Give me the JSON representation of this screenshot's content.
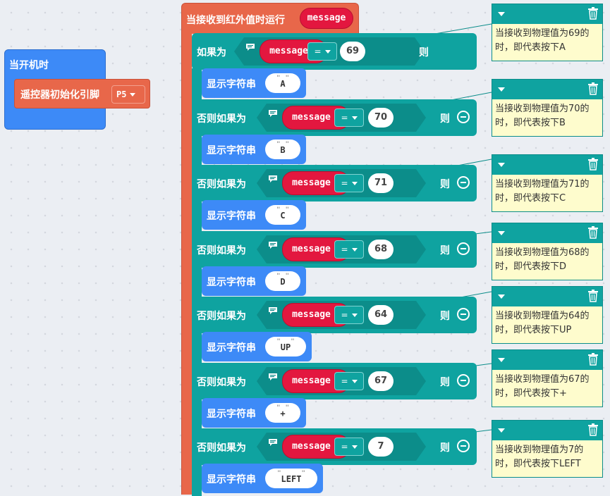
{
  "start_block": {
    "label": "当开机时",
    "init_label": "遥控器初始化引脚",
    "pin": "P5"
  },
  "ir_block": {
    "label": "当接收到红外值时运行",
    "var": "message"
  },
  "if_label": "如果为",
  "elseif_label": "否则如果为",
  "then_label": "则",
  "show_label": "显示字符串",
  "var_name": "message",
  "op": "=",
  "rows": [
    {
      "value": "69",
      "text": "A"
    },
    {
      "value": "70",
      "text": "B"
    },
    {
      "value": "71",
      "text": "C"
    },
    {
      "value": "68",
      "text": "D"
    },
    {
      "value": "64",
      "text": "UP"
    },
    {
      "value": "67",
      "text": "+"
    },
    {
      "value": "7",
      "text": "LEFT"
    }
  ],
  "comments": [
    "当接收到物理值为69的时，即代表按下A",
    "当接收到物理值为70的时，即代表按下B",
    "当接收到物理值为71的时，即代表按下C",
    "当接收到物理值为68的时，即代表按下D",
    "当接收到物理值为64的时，即代表按下UP",
    "当接收到物理值为67的时，即代表按下+",
    "当接收到物理值为7的时，即代表按下LEFT"
  ],
  "colors": {
    "event": "#e8674a",
    "control": "#0fa3a0",
    "display": "#3d8af7",
    "variable": "#e3173f",
    "comment": "#fefccd"
  }
}
